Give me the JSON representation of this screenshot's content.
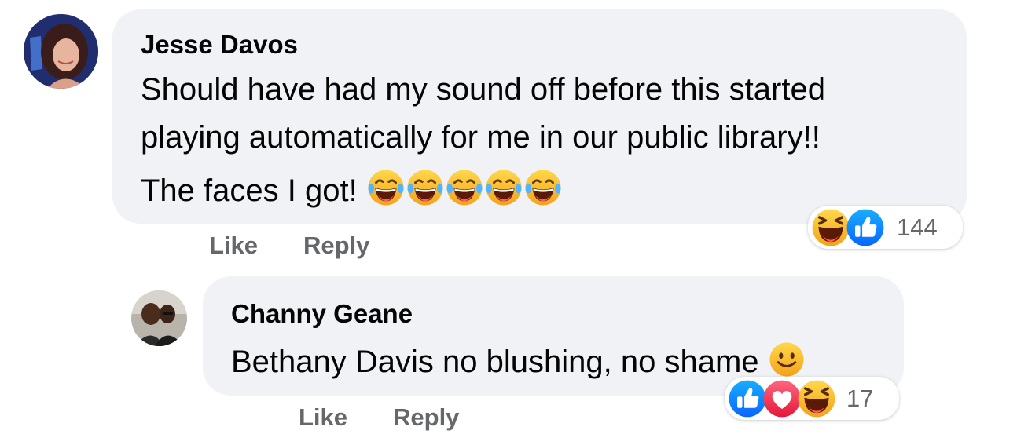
{
  "comments": [
    {
      "author": "Jesse Davos",
      "text_lines": [
        "Should have had my sound off before this started",
        "playing automatically for me in our public library!!",
        "The faces I got!"
      ],
      "inline_emojis": [
        "face-with-tears-of-joy",
        "face-with-tears-of-joy",
        "face-with-tears-of-joy",
        "face-with-tears-of-joy",
        "face-with-tears-of-joy"
      ],
      "actions": {
        "like": "Like",
        "reply": "Reply"
      },
      "reactions": {
        "icons": [
          "haha-reaction-icon",
          "like-reaction-icon"
        ],
        "count": "144"
      }
    },
    {
      "author": "Channy Geane",
      "text_lines": [
        "Bethany Davis no blushing, no shame"
      ],
      "inline_emojis": [
        "slightly-smiling-face"
      ],
      "actions": {
        "like": "Like",
        "reply": "Reply"
      },
      "reactions": {
        "icons": [
          "like-reaction-icon",
          "love-reaction-icon",
          "haha-reaction-icon"
        ],
        "count": "17"
      }
    }
  ],
  "colors": {
    "bubble": "#f0f2f5",
    "text": "#050505",
    "secondary": "#65676b",
    "like_blue": "#1877f2",
    "love_red": "#f33e58",
    "emoji_yellow": "#fbc02d"
  }
}
